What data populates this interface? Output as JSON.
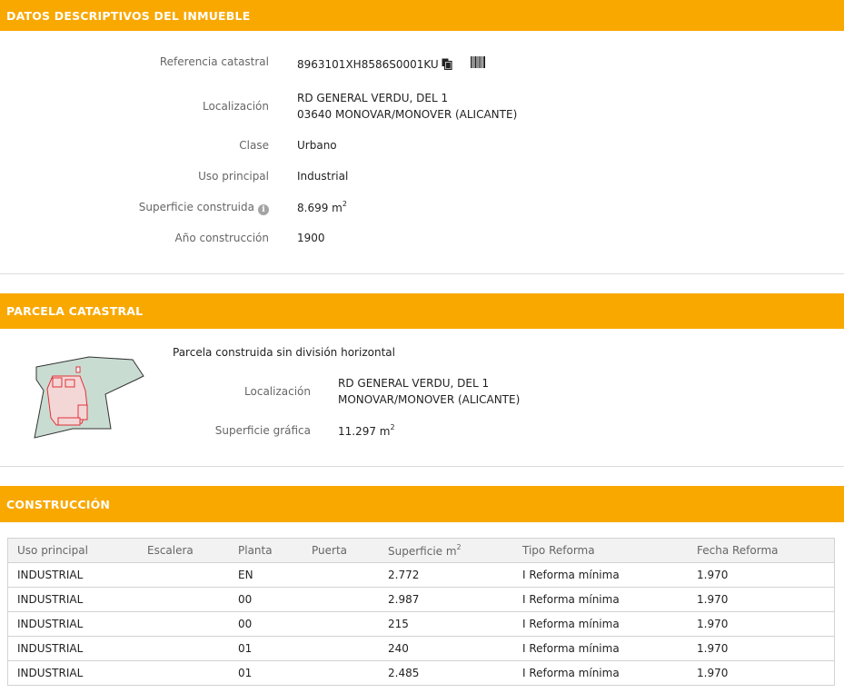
{
  "datos": {
    "header": "DATOS DESCRIPTIVOS DEL INMUEBLE",
    "referencia_label": "Referencia catastral",
    "referencia_value": "8963101XH8586S0001KU",
    "localizacion_label": "Localización",
    "localizacion_line1": "RD GENERAL VERDU, DEL 1",
    "localizacion_line2": "03640 MONOVAR/MONOVER (ALICANTE)",
    "clase_label": "Clase",
    "clase_value": "Urbano",
    "uso_label": "Uso principal",
    "uso_value": "Industrial",
    "superficie_label": "Superficie construida",
    "superficie_value": "8.699 m",
    "superficie_unit_sup": "2",
    "anio_label": "Año construcción",
    "anio_value": "1900"
  },
  "parcela": {
    "header": "PARCELA CATASTRAL",
    "tipo": "Parcela construida sin división horizontal",
    "localizacion_label": "Localización",
    "localizacion_line1": "RD GENERAL VERDU, DEL 1",
    "localizacion_line2": "MONOVAR/MONOVER (ALICANTE)",
    "superficie_label": "Superficie gráfica",
    "superficie_value": "11.297 m",
    "superficie_unit_sup": "2"
  },
  "construccion": {
    "header": "CONSTRUCCIÓN",
    "columns": [
      "Uso principal",
      "Escalera",
      "Planta",
      "Puerta",
      "Superficie m",
      "Tipo Reforma",
      "Fecha Reforma"
    ],
    "superficie_col_sup": "2",
    "rows": [
      [
        "INDUSTRIAL",
        "",
        "EN",
        "",
        "2.772",
        "I Reforma mínima",
        "1.970"
      ],
      [
        "INDUSTRIAL",
        "",
        "00",
        "",
        "2.987",
        "I Reforma mínima",
        "1.970"
      ],
      [
        "INDUSTRIAL",
        "",
        "00",
        "",
        "215",
        "I Reforma mínima",
        "1.970"
      ],
      [
        "INDUSTRIAL",
        "",
        "01",
        "",
        "240",
        "I Reforma mínima",
        "1.970"
      ],
      [
        "INDUSTRIAL",
        "",
        "01",
        "",
        "2.485",
        "I Reforma mínima",
        "1.970"
      ]
    ]
  },
  "icons": {
    "copy": "copy-icon",
    "barcode": "barcode-icon",
    "info": "info-icon",
    "info_glyph": "i"
  },
  "colors": {
    "header_bg": "#f9a800",
    "plot_fill": "#c9dcd2",
    "building_outline": "#e0303a"
  }
}
